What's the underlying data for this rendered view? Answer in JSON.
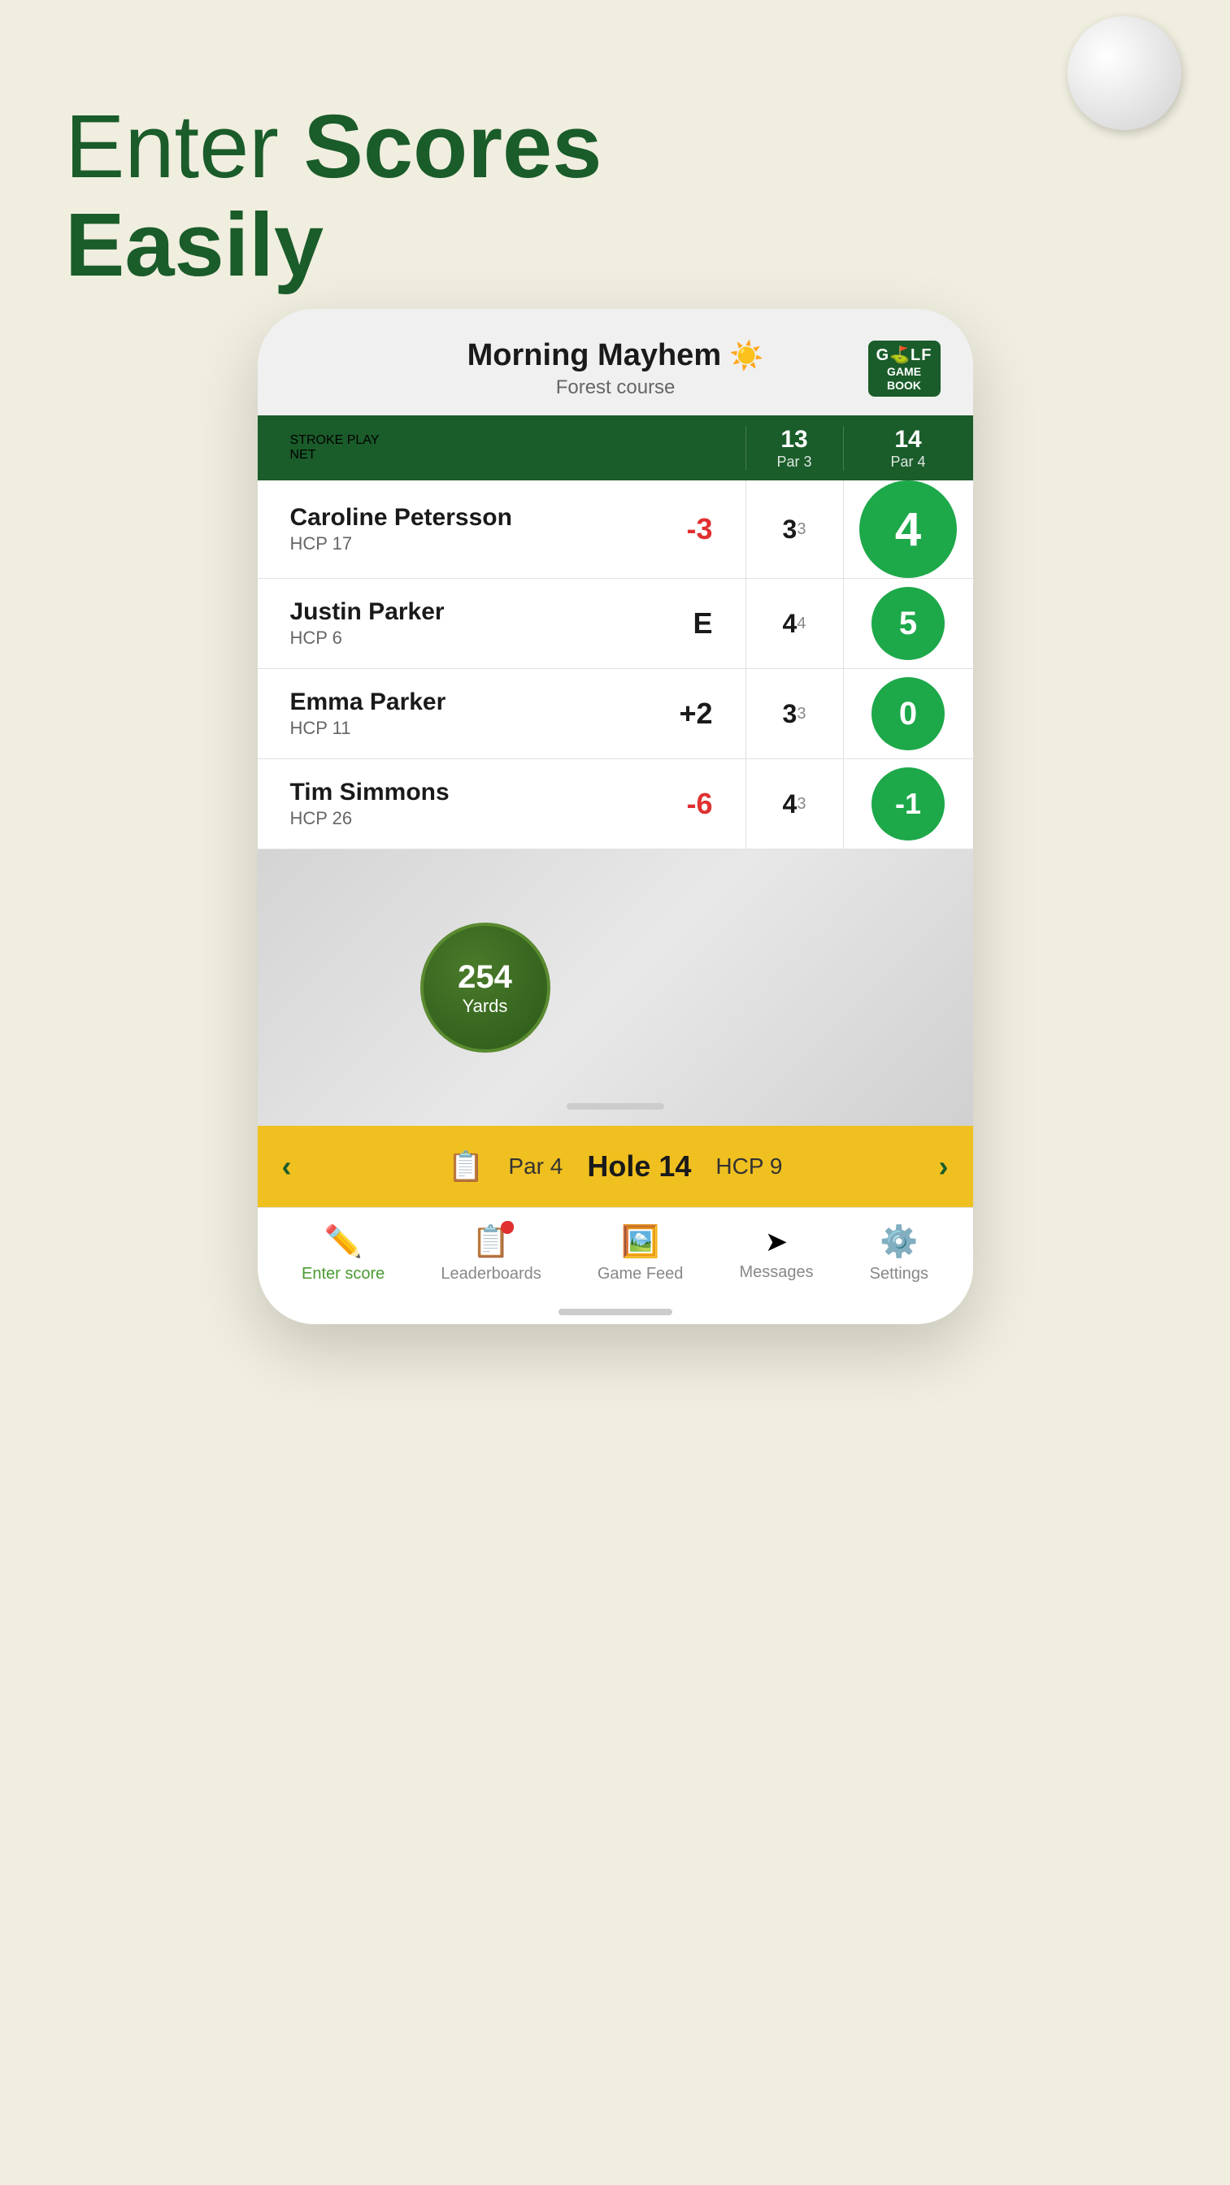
{
  "page": {
    "background_color": "#f0eedf"
  },
  "hero": {
    "line1_light": "Enter",
    "line1_bold": "Scores",
    "line2_bold": "Easily"
  },
  "phone": {
    "header": {
      "round_name": "Morning Mayhem",
      "sun_emoji": "☀️",
      "course_name": "Forest course",
      "logo_line1": "G⛳LF",
      "logo_line2": "GAME",
      "logo_line3": "BOOK"
    },
    "scorecard": {
      "play_type": "STROKE PLAY",
      "play_sub": "NET",
      "holes": [
        {
          "number": "13",
          "par": "Par 3"
        },
        {
          "number": "14",
          "par": "Par 4"
        }
      ]
    },
    "players": [
      {
        "name": "Caroline Petersson",
        "hcp": "HCP 17",
        "total_score": "-3",
        "total_color": "red",
        "hole13_score": "3",
        "hole13_sub": "3",
        "hole14_score": "4",
        "hole14_active": true
      },
      {
        "name": "Justin Parker",
        "hcp": "HCP 6",
        "total_score": "E",
        "total_color": "black",
        "hole13_score": "4",
        "hole13_sub": "4",
        "hole14_score": "5",
        "hole14_active": false
      },
      {
        "name": "Emma Parker",
        "hcp": "HCP 11",
        "total_score": "+2",
        "total_color": "black",
        "hole13_score": "3",
        "hole13_sub": "3",
        "hole14_score": "0",
        "hole14_active": false
      },
      {
        "name": "Tim Simmons",
        "hcp": "HCP 26",
        "total_score": "-6",
        "total_color": "red",
        "hole13_score": "4",
        "hole13_sub": "3",
        "hole14_score": "-1",
        "hole14_active": false
      }
    ],
    "map": {
      "yards": "254",
      "yards_label": "Yards"
    },
    "hole_bar": {
      "par": "Par 4",
      "hole": "Hole 14",
      "hcp": "HCP 9",
      "prev_arrow": "‹",
      "next_arrow": "›"
    },
    "bottom_nav": [
      {
        "label": "Enter score",
        "icon": "✏️",
        "active": true
      },
      {
        "label": "Leaderboards",
        "icon": "📋",
        "active": false,
        "badge": true
      },
      {
        "label": "Game Feed",
        "icon": "🖼️",
        "active": false
      },
      {
        "label": "Messages",
        "icon": "➤",
        "active": false
      },
      {
        "label": "Settings",
        "icon": "⚙️",
        "active": false
      }
    ]
  }
}
